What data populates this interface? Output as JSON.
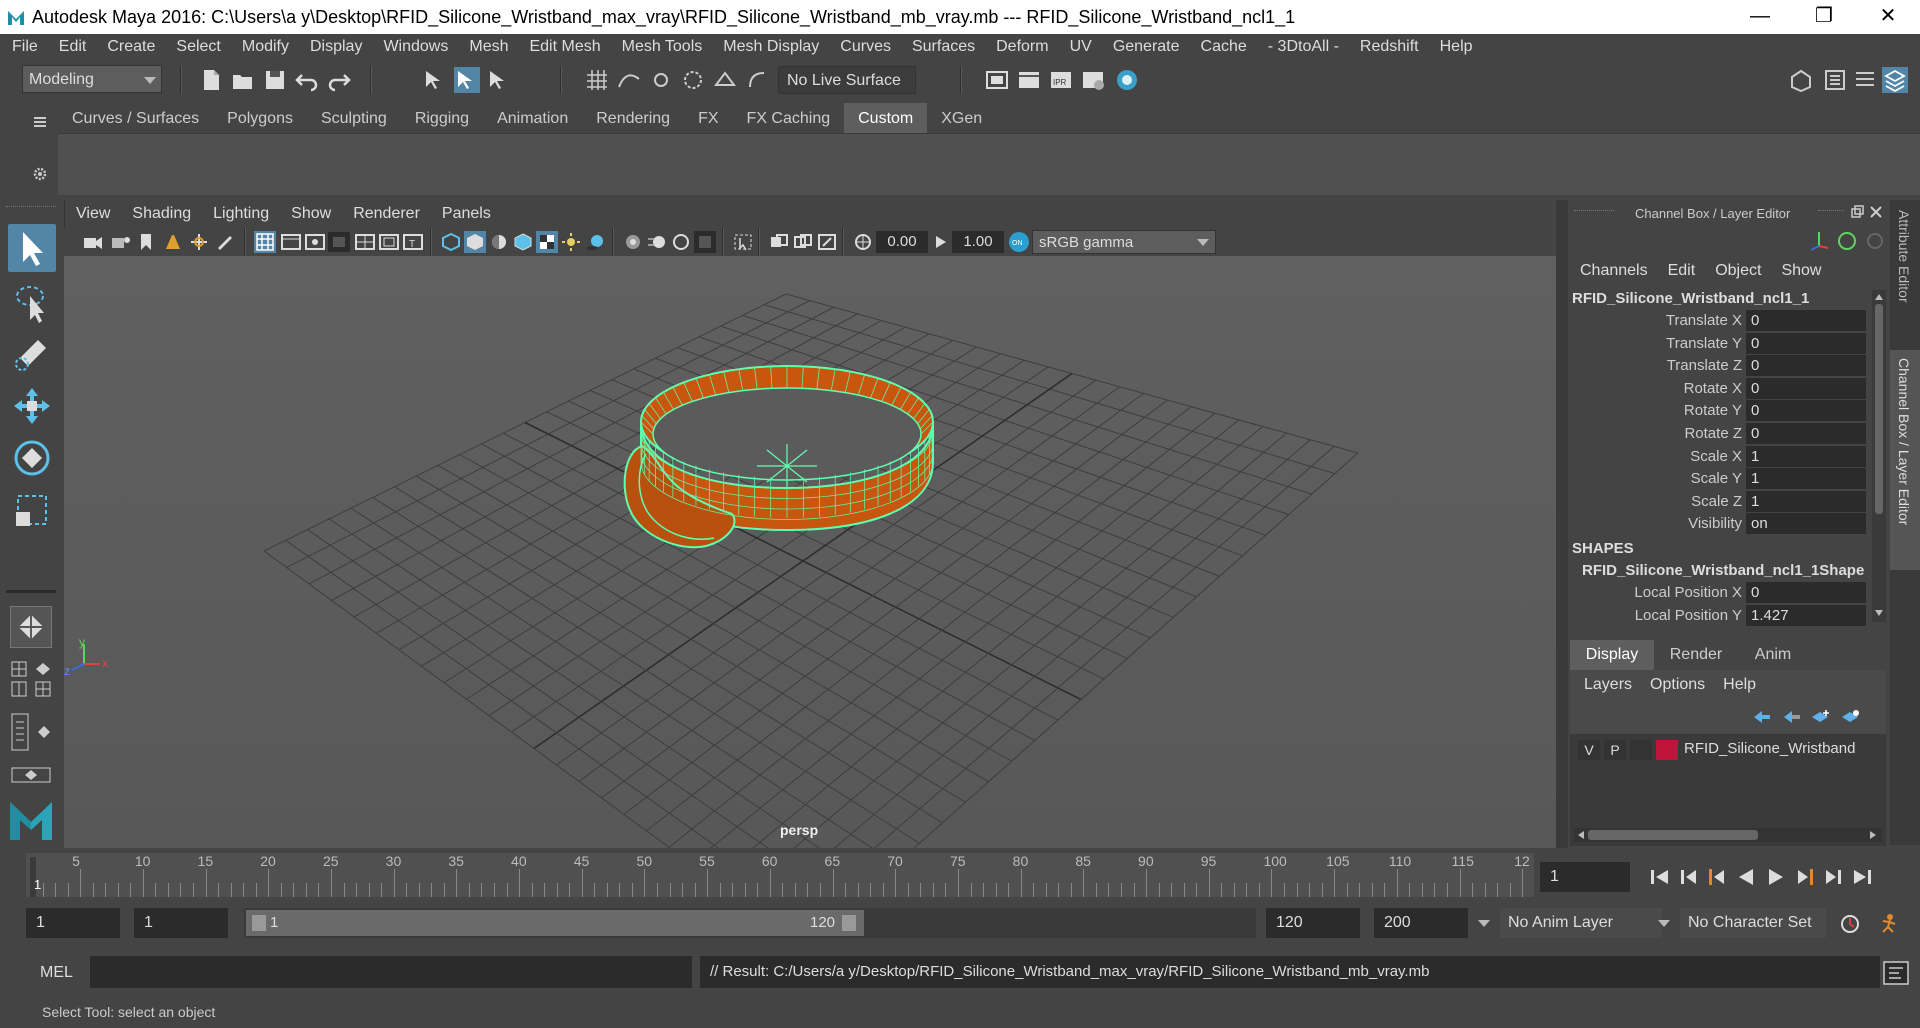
{
  "window": {
    "title": "Autodesk Maya 2016: C:\\Users\\a y\\Desktop\\RFID_Silicone_Wristband_max_vray\\RFID_Silicone_Wristband_mb_vray.mb   ---   RFID_Silicone_Wristband_ncl1_1",
    "minimize": "—",
    "maximize": "❐",
    "close": "✕"
  },
  "menubar": [
    "File",
    "Edit",
    "Create",
    "Select",
    "Modify",
    "Display",
    "Windows",
    "Mesh",
    "Edit Mesh",
    "Mesh Tools",
    "Mesh Display",
    "Curves",
    "Surfaces",
    "Deform",
    "UV",
    "Generate",
    "Cache",
    "- 3DtoAll -",
    "Redshift",
    "Help"
  ],
  "statusline": {
    "mode": "Modeling",
    "live_surface": "No Live Surface"
  },
  "shelf": {
    "tabs": [
      "Curves / Surfaces",
      "Polygons",
      "Sculpting",
      "Rigging",
      "Animation",
      "Rendering",
      "FX",
      "FX Caching",
      "Custom",
      "XGen"
    ],
    "active": "Custom"
  },
  "viewport": {
    "menus": [
      "View",
      "Shading",
      "Lighting",
      "Show",
      "Renderer",
      "Panels"
    ],
    "exposure": "0.00",
    "gamma": "1.00",
    "color_space": "sRGB gamma",
    "camera_label": "persp",
    "axis_y": "y",
    "axis_x": "x",
    "axis_z": "z"
  },
  "channel_box": {
    "panel_title": "Channel Box / Layer Editor",
    "menus": [
      "Channels",
      "Edit",
      "Object",
      "Show"
    ],
    "object_name": "RFID_Silicone_Wristband_ncl1_1",
    "channels": [
      {
        "label": "Translate X",
        "value": "0"
      },
      {
        "label": "Translate Y",
        "value": "0"
      },
      {
        "label": "Translate Z",
        "value": "0"
      },
      {
        "label": "Rotate X",
        "value": "0"
      },
      {
        "label": "Rotate Y",
        "value": "0"
      },
      {
        "label": "Rotate Z",
        "value": "0"
      },
      {
        "label": "Scale X",
        "value": "1"
      },
      {
        "label": "Scale Y",
        "value": "1"
      },
      {
        "label": "Scale Z",
        "value": "1"
      },
      {
        "label": "Visibility",
        "value": "on"
      }
    ],
    "shapes_header": "SHAPES",
    "shape_name": "RFID_Silicone_Wristband_ncl1_1Shape",
    "shape_channels": [
      {
        "label": "Local Position X",
        "value": "0"
      },
      {
        "label": "Local Position Y",
        "value": "1.427"
      }
    ]
  },
  "layer_editor": {
    "tabs": [
      "Display",
      "Render",
      "Anim"
    ],
    "active_tab": "Display",
    "menus": [
      "Layers",
      "Options",
      "Help"
    ],
    "layer": {
      "v": "V",
      "p": "P",
      "name": "RFID_Silicone_Wristband",
      "color": "#c0143c"
    }
  },
  "side_tabs": [
    "Attribute Editor",
    "Channel Box / Layer Editor"
  ],
  "timeline": {
    "ticks": [
      "5",
      "10",
      "15",
      "20",
      "25",
      "30",
      "35",
      "40",
      "45",
      "50",
      "55",
      "60",
      "65",
      "70",
      "75",
      "80",
      "85",
      "90",
      "95",
      "100",
      "105",
      "110",
      "115",
      "12"
    ],
    "start_marker": "1",
    "current_frame": "1"
  },
  "range": {
    "start": "1",
    "playback_start": "1",
    "slider_start": "1",
    "slider_end": "120",
    "playback_end": "120",
    "end": "200",
    "anim_layer": "No Anim Layer",
    "character_set": "No Character Set"
  },
  "command": {
    "language": "MEL",
    "input": "",
    "result": "// Result: C:/Users/a y/Desktop/RFID_Silicone_Wristband_max_vray/RFID_Silicone_Wristband_mb_vray.mb"
  },
  "help_line": "Select Tool: select an object",
  "colors": {
    "mesh_fill": "#c8560e",
    "wire_highlight": "#5fffb0",
    "active_tab": "#5e5e5e",
    "accent_blue": "#5285a6"
  }
}
